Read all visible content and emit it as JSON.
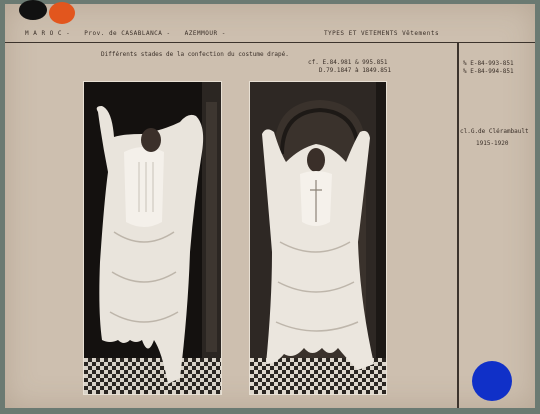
{
  "header": {
    "country": "M A R O C",
    "province": "Prov. de  CASABLANCA",
    "city": "AZEMMOUR",
    "category": "TYPES ET VETEMENTS  Vêtements"
  },
  "caption": "Différents stades de la confection du costume drapé.",
  "references": {
    "line1": "cf. E.84.981 & 995.851",
    "line2": "D.79.1847 à 1849.851"
  },
  "side": {
    "code1": "% E-84-993-851",
    "code2": "% E-84-994-851",
    "credit": "cl.G.de Clérambault",
    "years": "1915-1920"
  },
  "colors": {
    "card": "#cdbfaf",
    "ink": "#3a2f28",
    "blue_dot": "#1030c8",
    "orange_dot": "#e2561e"
  }
}
